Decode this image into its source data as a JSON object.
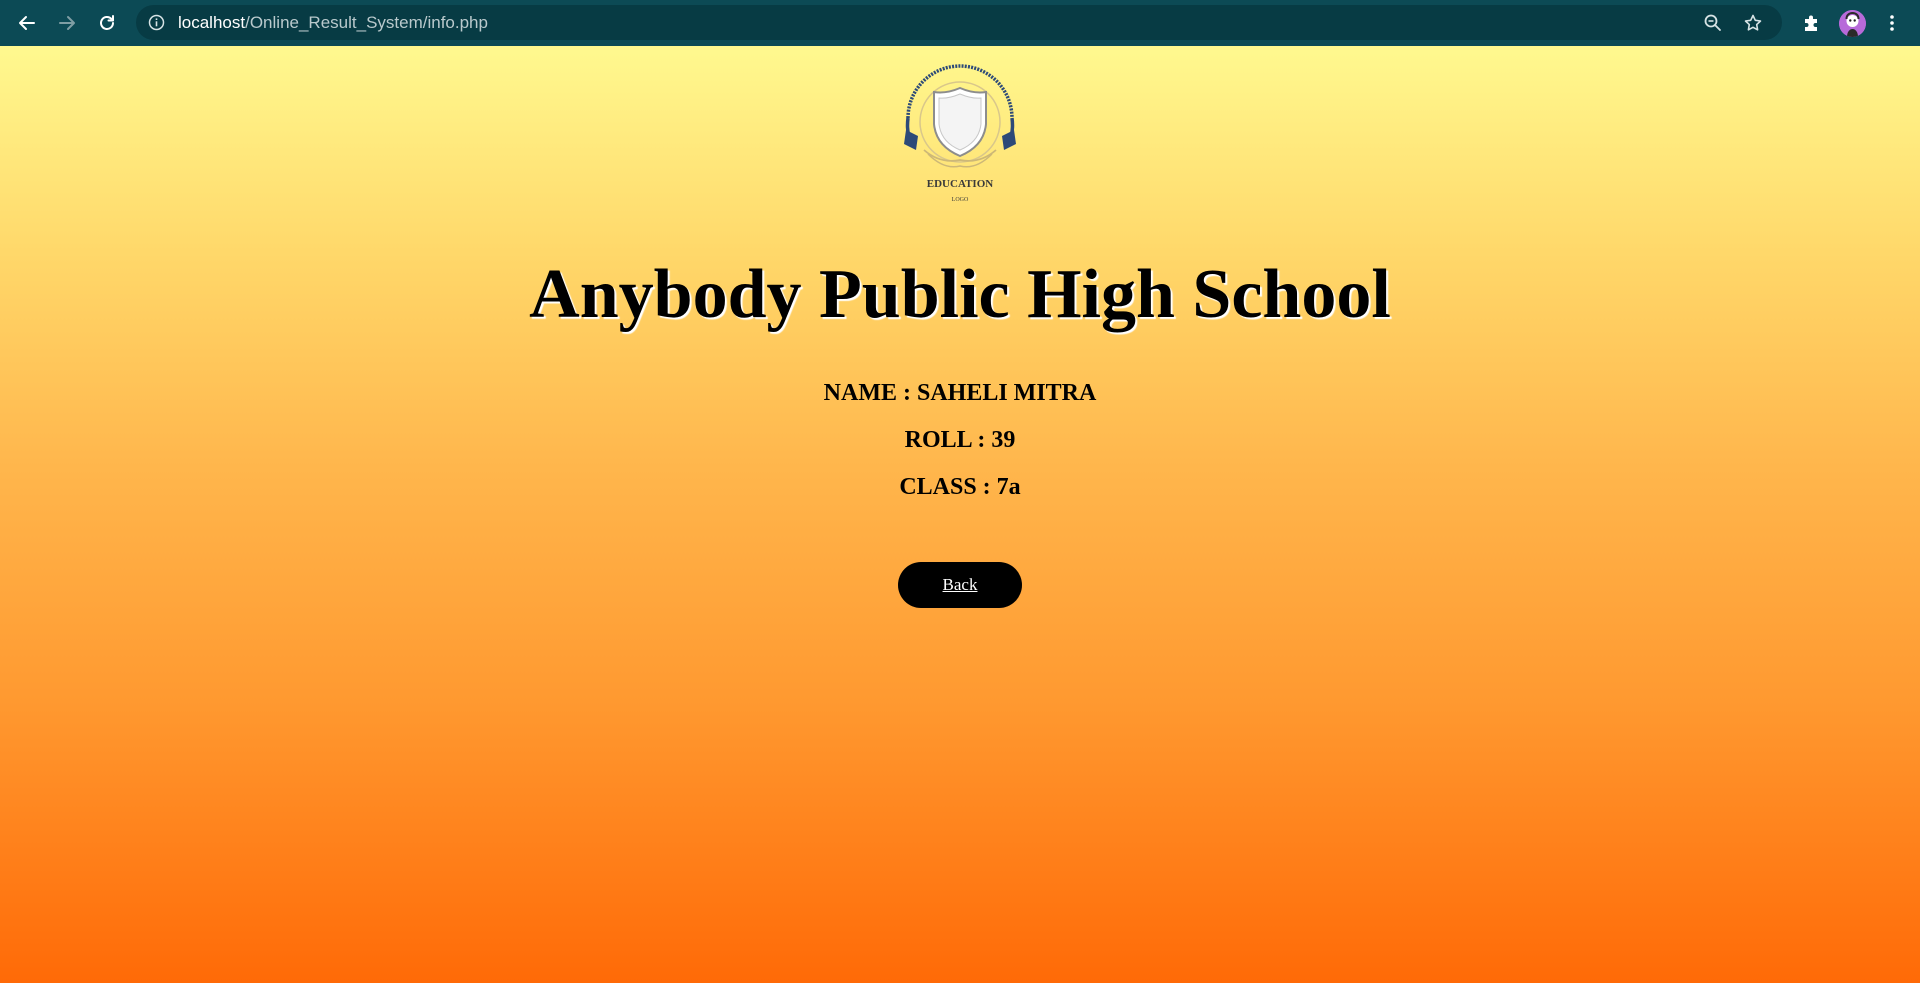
{
  "browser": {
    "url_host": "localhost",
    "url_path": "/Online_Result_System/info.php",
    "icons": {
      "back": "back-arrow-icon",
      "forward": "forward-arrow-icon",
      "reload": "reload-icon",
      "site_info": "info-icon",
      "zoom": "zoom-icon",
      "bookmark": "star-icon",
      "extensions": "puzzle-icon",
      "profile": "avatar",
      "menu": "kebab-menu-icon"
    },
    "colors": {
      "toolbar": "#0c4a55",
      "omnibox": "#073b44"
    }
  },
  "page": {
    "logo": {
      "line1": "EDUCATION",
      "line2": "LOGO"
    },
    "school_name": "Anybody Public High School",
    "student": {
      "name_line": "NAME : SAHELI MITRA",
      "roll_line": "ROLL : 39",
      "class_line": "CLASS : 7a"
    },
    "back_label": "Back",
    "colors": {
      "gradient_top": "#fff98f",
      "gradient_bottom": "#ff6a07",
      "button": "#000000"
    }
  }
}
